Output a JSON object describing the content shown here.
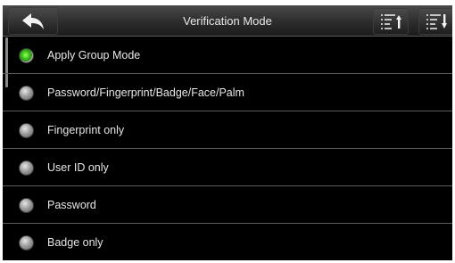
{
  "header": {
    "title": "Verification Mode",
    "back_icon": "back-arrow-icon",
    "sort_ascending_icon": "sort-ascending-icon",
    "sort_descending_icon": "sort-descending-icon"
  },
  "options": [
    {
      "label": "Apply Group Mode",
      "selected": true
    },
    {
      "label": "Password/Fingerprint/Badge/Face/Palm",
      "selected": false
    },
    {
      "label": "Fingerprint only",
      "selected": false
    },
    {
      "label": "User ID only",
      "selected": false
    },
    {
      "label": "Password",
      "selected": false
    },
    {
      "label": "Badge only",
      "selected": false
    }
  ],
  "colors": {
    "selected_radio": "#3cc81c",
    "background": "#000000",
    "text": "#e6e6e6"
  }
}
